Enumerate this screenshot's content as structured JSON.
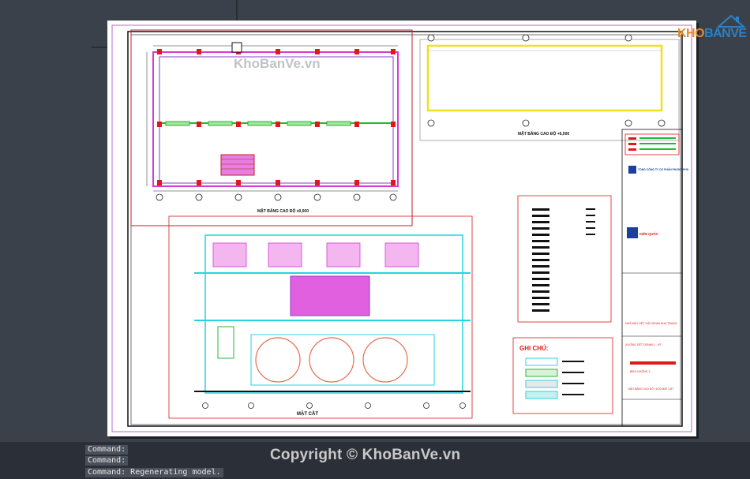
{
  "watermark": {
    "site_top": "KhoBanVe.vn",
    "site_logo_prefix": "KHO",
    "site_logo_suffix": "BANVE",
    "copyright": "Copyright © KhoBanVe.vn"
  },
  "drawing": {
    "plan_title_1": "MẶT BẰNG CAO ĐỘ ±0,000",
    "plan_title_2": "MẶT BẰNG CAO ĐỘ +6,000",
    "section_title": "MẶT CẮT",
    "notes_title": "GHI CHÚ:",
    "title_block": {
      "company_1": "TỔNG CÔNG TY CỔ PHẦN PHONG PHÚ",
      "company_2": "KIẾN QUỐC",
      "project": "NHÀ MÁY DỆT VẢI DENIM NHA TRANG",
      "sheet_desc": "XƯỞNG DỆT DENIM 1 - HT",
      "phase": "BIỂU KHÔNG 2",
      "sheet_name": "MẶT BẰNG CAO ĐỘ +6,00 MẶT CẮT"
    }
  },
  "command_line": {
    "lines": [
      "Command:",
      "Command:",
      "Command: Regenerating model."
    ]
  },
  "colors": {
    "background": "#3a414b",
    "sheet": "#ffffff",
    "red": "#e01818",
    "magenta": "#d63ad6",
    "cyan": "#24d4e0",
    "yellow": "#f0e020",
    "green": "#24b838",
    "purple": "#8a3cc8"
  }
}
